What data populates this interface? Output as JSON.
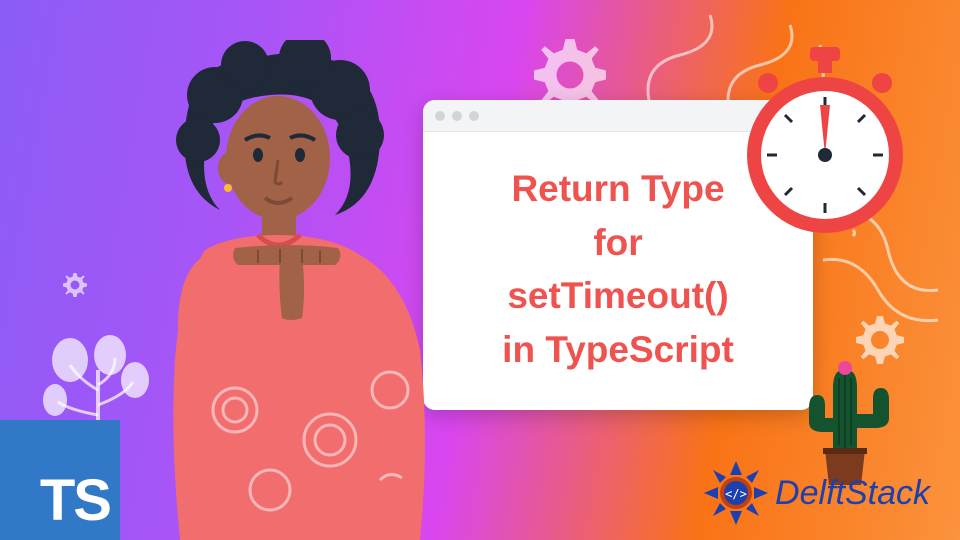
{
  "card": {
    "line1": "Return Type",
    "line2": "for",
    "line3": "setTimeout()",
    "line4": "in TypeScript"
  },
  "ts_logo": "TS",
  "brand": "DelftStack",
  "colors": {
    "accent": "#ef5350",
    "ts_blue": "#3178c6",
    "brand_blue": "#1e40af"
  }
}
